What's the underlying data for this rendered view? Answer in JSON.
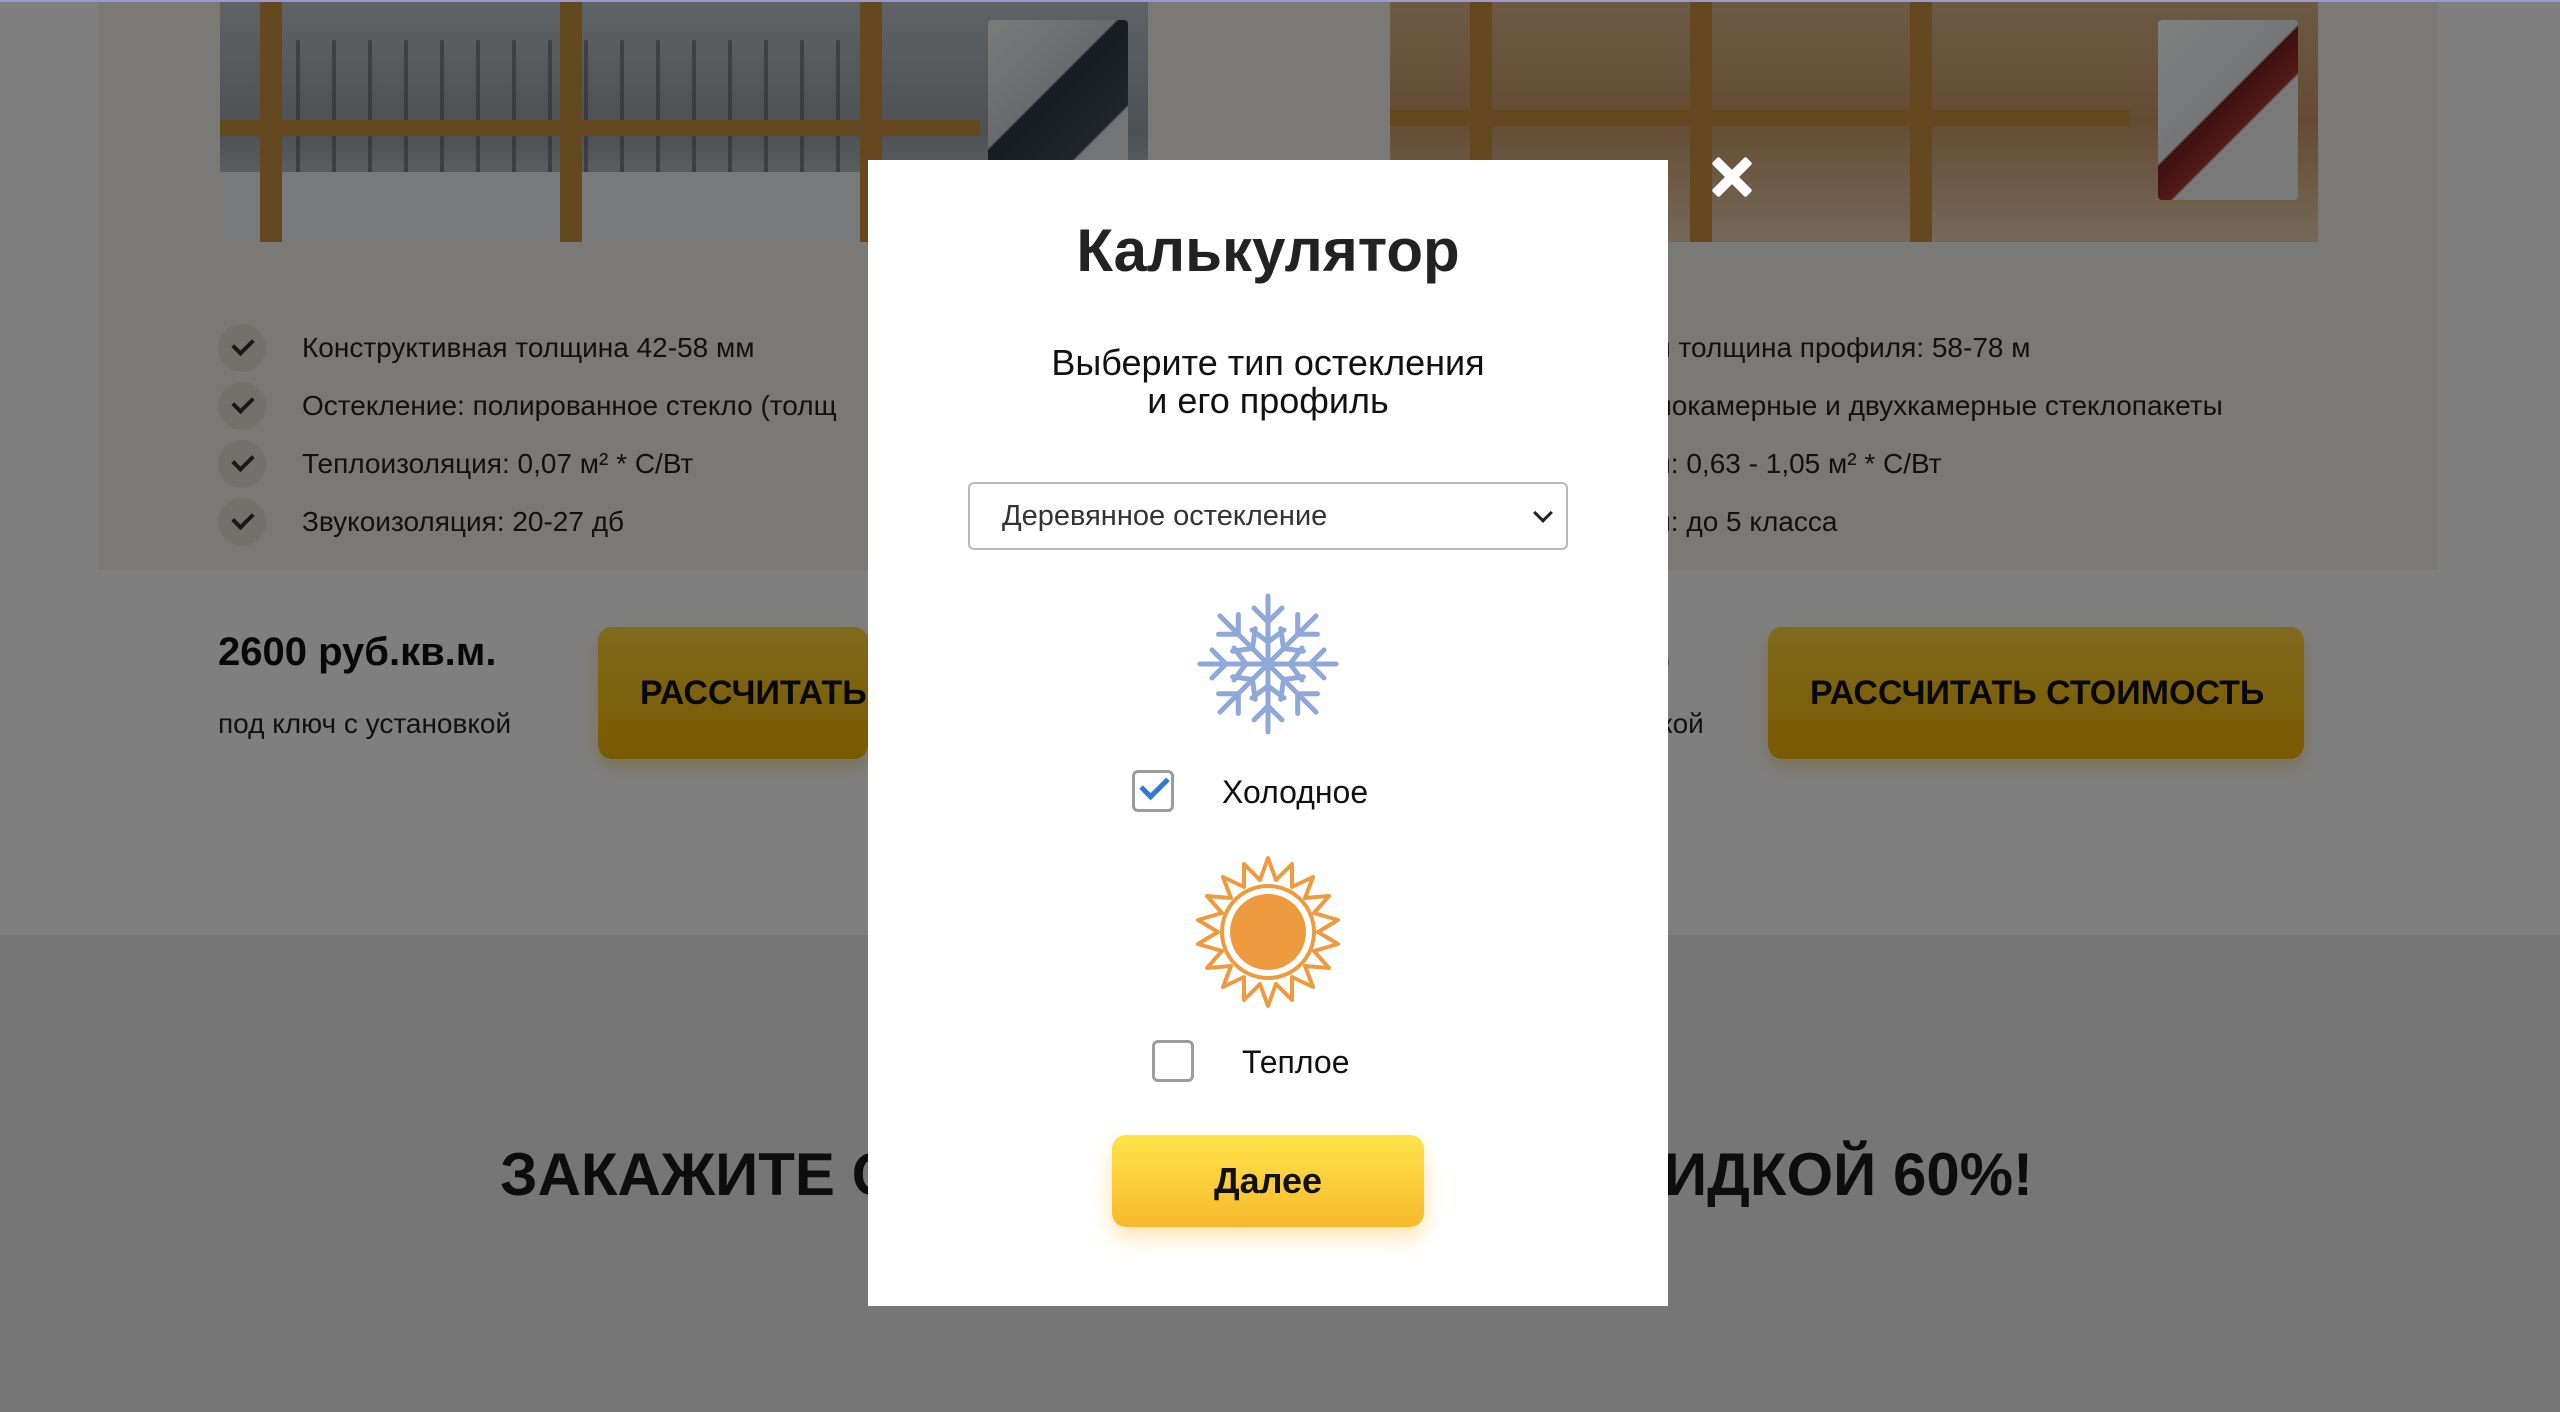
{
  "background": {
    "left_card": {
      "features": [
        "Конструктивная толщина 42-58 мм",
        "Остекление: полированное стекло (толщ",
        "Теплоизоляция: 0,07 м² * С/Вт",
        "Звукоизоляция: 20-27 дб"
      ],
      "price": "2600 руб.кв.м.",
      "price_sub": "под ключ с установкой",
      "button": "РАССЧИТАТЬ"
    },
    "right_card": {
      "features": [
        "ая толщина профиля: 58-78 м",
        "днокамерные и двухкамерные стеклопакеты",
        "ия: 0,63 - 1,05 м² * С/Вт",
        "ия: до 5 класса"
      ],
      "price": ".",
      "price_sub": "кой",
      "button": "РАССЧИТАТЬ СТОИМОСТЬ"
    },
    "headline_left": "ЗАКАЖИТЕ С",
    "headline_right": "ИДКОЙ 60%!"
  },
  "modal": {
    "title": "Калькулятор",
    "subtitle_line1": "Выберите тип остекления",
    "subtitle_line2": "и его профиль",
    "select_value": "Деревянное остекление",
    "option_cold": {
      "label": "Холодное",
      "checked": true,
      "icon": "snowflake-icon"
    },
    "option_warm": {
      "label": "Теплое",
      "checked": false,
      "icon": "sun-icon"
    },
    "next_button": "Далее",
    "close_icon": "close-icon"
  },
  "colors": {
    "accent_yellow": "#f7b92c",
    "snowflake": "#8fa8d8",
    "sun": "#ee9a3e",
    "checkbox_check": "#2f7ad8"
  }
}
